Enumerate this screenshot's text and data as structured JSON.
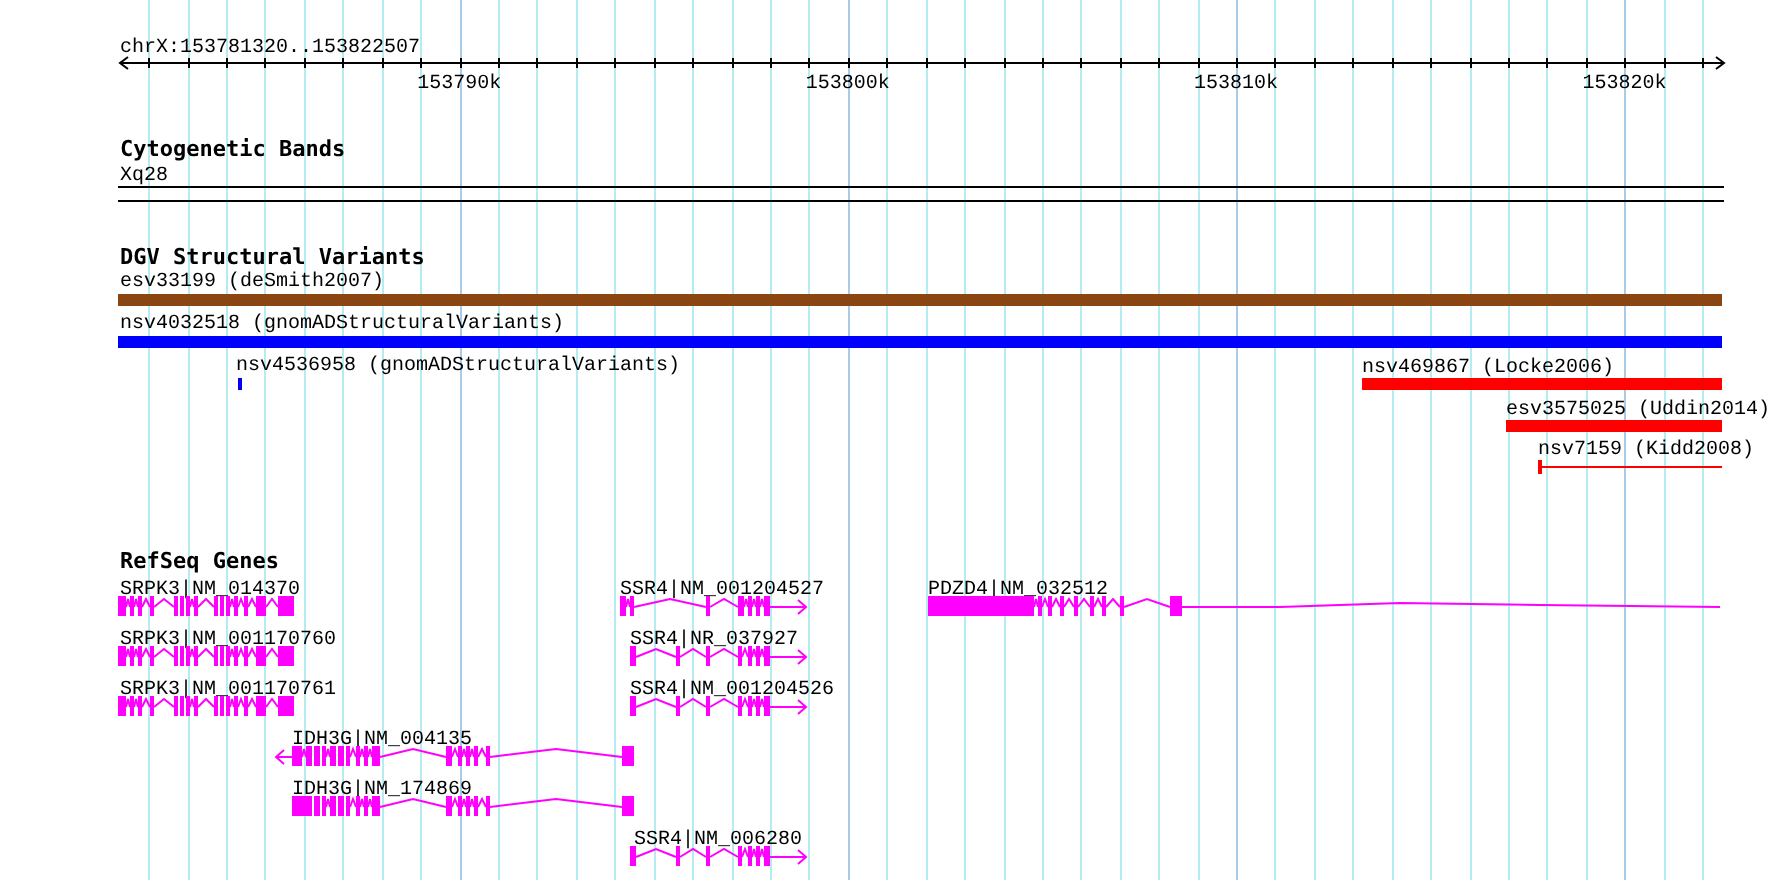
{
  "ruler": {
    "label": "chrX:153781320..153822507",
    "ticks": [
      "153790k",
      "153800k",
      "153810k",
      "153820k"
    ]
  },
  "tracks": [
    {
      "title": "Cytogenetic Bands",
      "features": [
        {
          "label": "Xq28",
          "kind": "band"
        }
      ]
    },
    {
      "title": "DGV Structural Variants",
      "features": [
        {
          "label": "esv33199 (deSmith2007)",
          "kind": "bar",
          "color": "#8b4513"
        },
        {
          "label": "nsv4032518 (gnomADStructuralVariants)",
          "kind": "bar",
          "color": "#0000ff"
        },
        {
          "label": "nsv4536958 (gnomADStructuralVariants)",
          "kind": "bar",
          "color": "#0000ff"
        },
        {
          "label": "nsv469867 (Locke2006)",
          "kind": "bar",
          "color": "#ff0000"
        },
        {
          "label": "esv3575025 (Uddin2014)",
          "kind": "bar",
          "color": "#ff0000"
        },
        {
          "label": "nsv7159 (Kidd2008)",
          "kind": "span",
          "color": "#ff0000"
        }
      ]
    },
    {
      "title": "RefSeq Genes",
      "features": [
        {
          "label": "SRPK3|NM_014370",
          "kind": "gene"
        },
        {
          "label": "SSR4|NM_001204527",
          "kind": "gene"
        },
        {
          "label": "PDZD4|NM_032512",
          "kind": "gene"
        },
        {
          "label": "SRPK3|NM_001170760",
          "kind": "gene"
        },
        {
          "label": "SSR4|NR_037927",
          "kind": "gene"
        },
        {
          "label": "SRPK3|NM_001170761",
          "kind": "gene"
        },
        {
          "label": "SSR4|NM_001204526",
          "kind": "gene"
        },
        {
          "label": "IDH3G|NM_004135",
          "kind": "gene"
        },
        {
          "label": "IDH3G|NM_174869",
          "kind": "gene"
        },
        {
          "label": "SSR4|NM_006280",
          "kind": "gene"
        }
      ]
    }
  ]
}
